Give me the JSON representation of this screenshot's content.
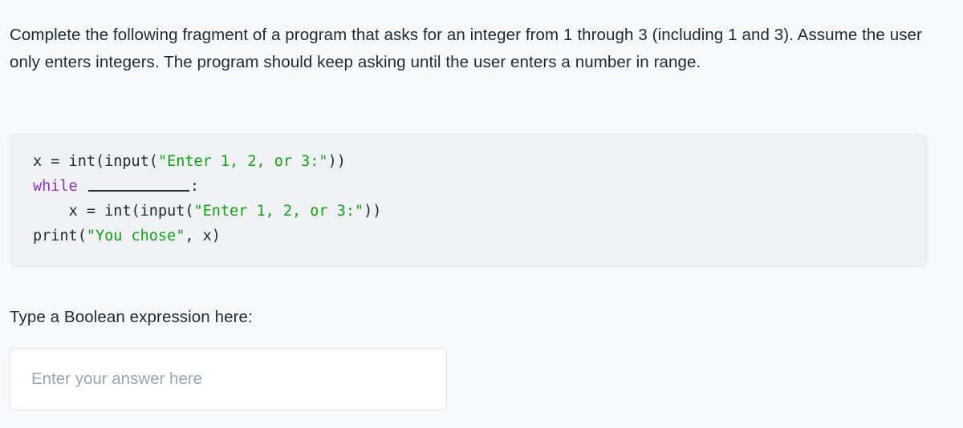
{
  "prompt": {
    "text": "Complete the following fragment of a program that asks for an integer from 1 through 3 (including 1 and 3). Assume the user only enters integers. The program should keep asking until the user enters a number in range."
  },
  "code": {
    "language": "python",
    "syntax_colors": {
      "string": "#10a310",
      "keyword": "#8e2fbd",
      "plain": "#1c2b33",
      "background": "#eff1f5",
      "border": "#e4e7ed"
    },
    "lines": [
      {
        "indent": "",
        "segments": [
          {
            "kind": "plain",
            "text": "x = int(input("
          },
          {
            "kind": "string",
            "text": "\"Enter 1, 2, or 3:\""
          },
          {
            "kind": "plain",
            "text": "))"
          }
        ]
      },
      {
        "indent": "",
        "segments": [
          {
            "kind": "keyword",
            "text": "while"
          },
          {
            "kind": "plain",
            "text": " "
          },
          {
            "kind": "blank",
            "text": ""
          },
          {
            "kind": "plain",
            "text": ":"
          }
        ]
      },
      {
        "indent": "    ",
        "segments": [
          {
            "kind": "plain",
            "text": "x = int(input("
          },
          {
            "kind": "string",
            "text": "\"Enter 1, 2, or 3:\""
          },
          {
            "kind": "plain",
            "text": "))"
          }
        ]
      },
      {
        "indent": "",
        "segments": [
          {
            "kind": "plain",
            "text": "print("
          },
          {
            "kind": "string",
            "text": "\"You chose\""
          },
          {
            "kind": "plain",
            "text": ", x)"
          }
        ]
      }
    ],
    "plain_text_line_1": "x = int(input(\"Enter 1, 2, or 3:\"))",
    "plain_text_line_2": "while __________:",
    "plain_text_line_3": "    x = int(input(\"Enter 1, 2, or 3:\"))",
    "plain_text_line_4": "print(\"You chose\", x)"
  },
  "answer": {
    "label": "Type a Boolean expression here:",
    "placeholder": "Enter your answer here",
    "value": ""
  },
  "theme": {
    "page_background": "#f7f8fa",
    "text_color": "#1b2a35",
    "placeholder_color": "#9aa4ae",
    "input_background": "#ffffff",
    "input_border": "#e1e5ea"
  }
}
